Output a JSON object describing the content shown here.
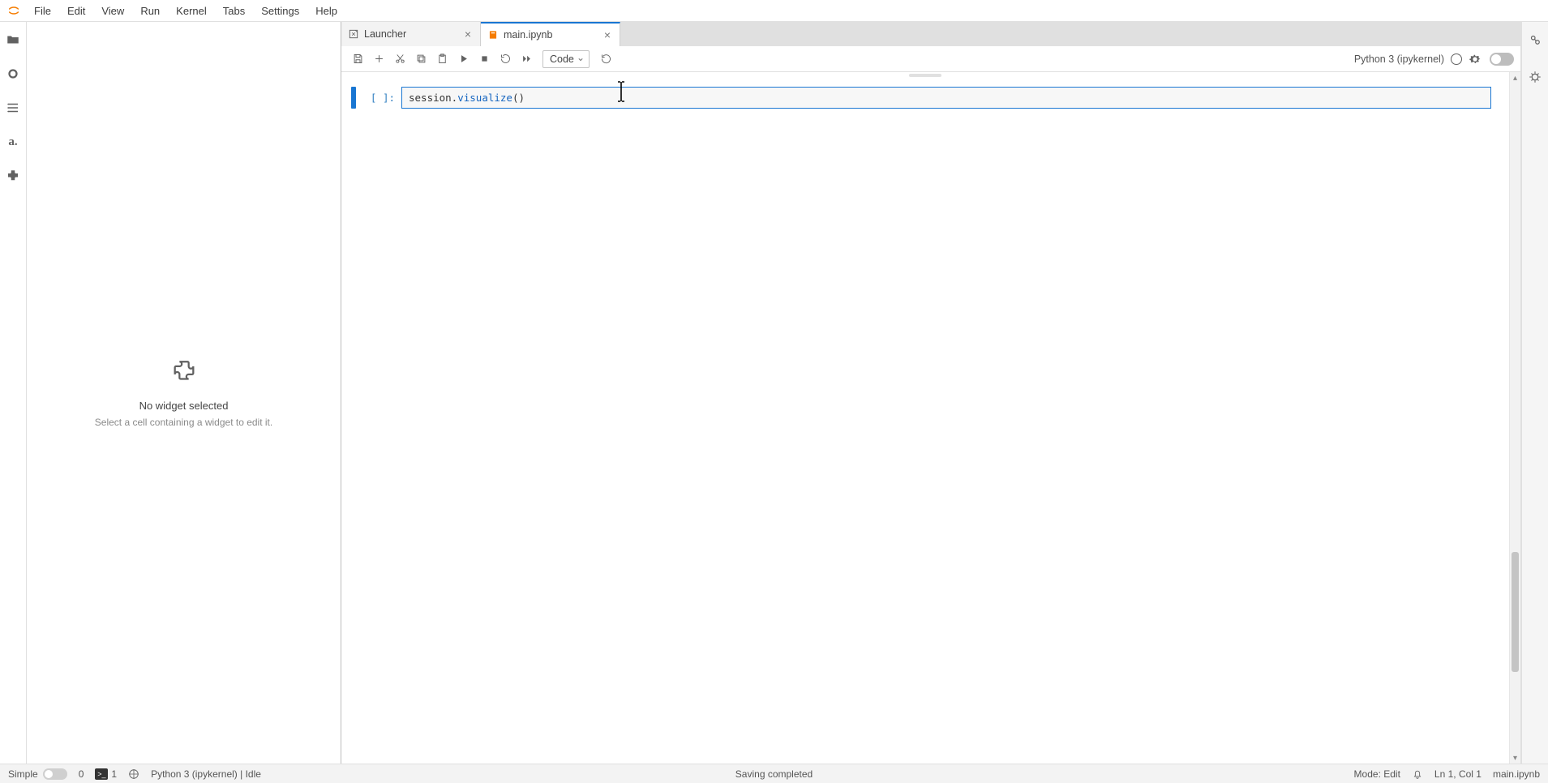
{
  "menu": {
    "items": [
      "File",
      "Edit",
      "View",
      "Run",
      "Kernel",
      "Tabs",
      "Settings",
      "Help"
    ]
  },
  "leftrail": {
    "items": [
      "folder",
      "circle",
      "list",
      "ai",
      "puzzle"
    ]
  },
  "sidebar": {
    "title": "No widget selected",
    "subtitle": "Select a cell containing a widget to edit it."
  },
  "tabs": [
    {
      "label": "Launcher",
      "icon": "launcher",
      "active": false
    },
    {
      "label": "main.ipynb",
      "icon": "notebook",
      "active": true
    }
  ],
  "toolbar": {
    "celltype": "Code",
    "kernel": "Python 3 (ipykernel)"
  },
  "cell": {
    "prompt": "[ ]:",
    "code_prefix": "session.",
    "code_method": "visualize",
    "code_suffix": "()"
  },
  "statusbar": {
    "simple": "Simple",
    "count0": "0",
    "count1": "1",
    "kernel": "Python 3 (ipykernel) | Idle",
    "center": "Saving completed",
    "mode": "Mode: Edit",
    "pos": "Ln 1, Col 1",
    "file": "main.ipynb"
  }
}
